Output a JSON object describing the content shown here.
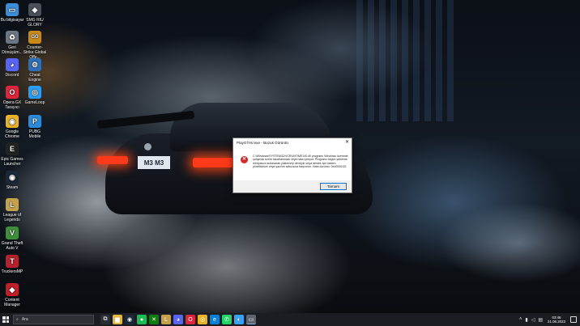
{
  "desktop_icons": [
    {
      "label": "Bu bilgisayar",
      "icon": "computer-icon",
      "color": "#3a8fd8"
    },
    {
      "label": "SMG RIU GLORY",
      "icon": "game-shortcut-icon",
      "color": "#4a4f58"
    },
    {
      "label": "Geri Dönüşüm...",
      "icon": "recycle-bin-icon",
      "color": "#6d7683"
    },
    {
      "label": "Counter-Strike Global Offe...",
      "icon": "csgo-icon",
      "color": "#c98a1a"
    },
    {
      "label": "Discord",
      "icon": "discord-icon",
      "color": "#5865f2"
    },
    {
      "label": "Cheat Engine",
      "icon": "cheat-engine-icon",
      "color": "#2d6fb8"
    },
    {
      "label": "Opera GX Tarayıcı",
      "icon": "opera-gx-icon",
      "color": "#e0243c"
    },
    {
      "label": "GameLoop",
      "icon": "gameloop-icon",
      "color": "#2a9df4"
    },
    {
      "label": "Google Chrome",
      "icon": "chrome-icon",
      "color": "#e9b229"
    },
    {
      "label": "PUBG Mobile",
      "icon": "pubg-icon",
      "color": "#2c8ad8"
    },
    {
      "label": "Epic Games Launcher",
      "icon": "epic-games-icon",
      "color": "#222222"
    },
    {
      "label": "Steam",
      "icon": "steam-icon",
      "color": "#1b2838"
    },
    {
      "label": "League of Legends",
      "icon": "league-icon",
      "color": "#c4a24c"
    },
    {
      "label": "Grand Theft Auto V",
      "icon": "gta-icon",
      "color": "#3e8f3a"
    },
    {
      "label": "TruckersMP",
      "icon": "truckersmp-icon",
      "color": "#b5212c"
    },
    {
      "label": "Content Manager",
      "icon": "content-manager-icon",
      "color": "#c0202a"
    }
  ],
  "car": {
    "plate": "M3 M3"
  },
  "dialog": {
    "title": "PlayGTAV.exe - Bozuk Görüntü",
    "close_glyph": "✕",
    "error_glyph": "✕",
    "message": "C:\\Windows\\SYSTEM32\\VCRUNTIME140.dll programı Windows üzerinde çalışmak üzere tasarlanmadı veya hata içeriyor. Programı özgün yükleme medyasını kullanarak yüklemeyi deneyin veya destek için sistem yöneticinize veya yazılım satıcısına başvurun. Hata durumu: 0xc000012f.",
    "ok_label": "Tamam"
  },
  "taskbar": {
    "search_placeholder": "Ara",
    "search_icon": "search-icon",
    "apps": [
      {
        "name": "task-view-icon",
        "glyph": "⧉",
        "color": "#2b2e35"
      },
      {
        "name": "file-explorer-icon",
        "glyph": "▆",
        "color": "#e7b53b"
      },
      {
        "name": "steam-icon",
        "glyph": "◉",
        "color": "#1b2838"
      },
      {
        "name": "spotify-icon",
        "glyph": "●",
        "color": "#1db954"
      },
      {
        "name": "xbox-icon",
        "glyph": "✕",
        "color": "#107c10"
      },
      {
        "name": "league-icon",
        "glyph": "L",
        "color": "#c4a24c"
      },
      {
        "name": "discord-icon",
        "glyph": "◕",
        "color": "#5865f2"
      },
      {
        "name": "opera-gx-icon",
        "glyph": "O",
        "color": "#e0243c"
      },
      {
        "name": "chrome-icon",
        "glyph": "◎",
        "color": "#e9b229"
      },
      {
        "name": "edge-icon",
        "glyph": "e",
        "color": "#0b7fd6"
      },
      {
        "name": "whatsapp-icon",
        "glyph": "✆",
        "color": "#25d366"
      },
      {
        "name": "app-icon",
        "glyph": "◐",
        "color": "#3aa0f0"
      },
      {
        "name": "active-window-icon",
        "glyph": "▭",
        "color": "#5d6470"
      }
    ],
    "tray_icons": [
      {
        "name": "chevron-up-icon",
        "glyph": "˄"
      },
      {
        "name": "network-icon",
        "glyph": "▮"
      },
      {
        "name": "volume-icon",
        "glyph": "◁"
      },
      {
        "name": "language-icon",
        "glyph": "▤"
      }
    ],
    "time": "03:46",
    "date": "21.06.2023"
  }
}
